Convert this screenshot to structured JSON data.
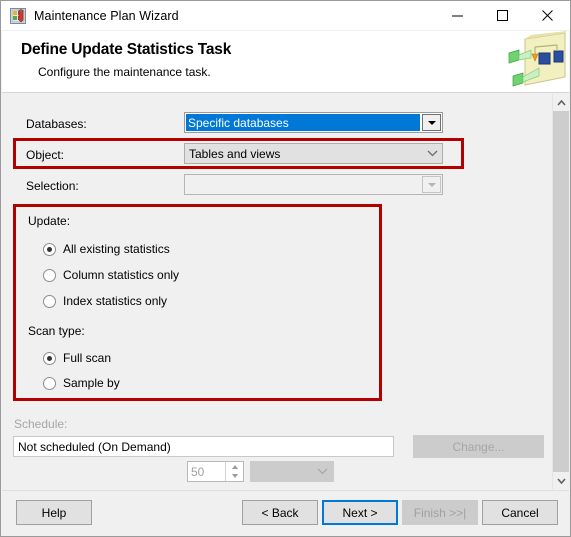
{
  "window": {
    "title": "Maintenance Plan Wizard",
    "icon": "maintenance-plan-icon",
    "caption_buttons": {
      "minimize": "minimize-icon",
      "maximize": "maximize-icon",
      "close": "close-icon"
    }
  },
  "header": {
    "title": "Define Update Statistics Task",
    "subtitle": "Configure the maintenance task.",
    "art": "maintenance-plan-diagram-icon"
  },
  "form": {
    "databases": {
      "label": "Databases:",
      "value": "Specific databases",
      "state": "selected"
    },
    "object": {
      "label": "Object:",
      "value": "Tables and views",
      "state": "enabled",
      "highlighted": true
    },
    "selection": {
      "label": "Selection:",
      "value": "",
      "placeholder": "",
      "state": "disabled"
    }
  },
  "update_group": {
    "highlighted": true,
    "title": "Update:",
    "options": [
      {
        "label": "All existing statistics",
        "checked": true
      },
      {
        "label": "Column statistics only",
        "checked": false
      },
      {
        "label": "Index statistics only",
        "checked": false
      }
    ],
    "scan_type": {
      "title": "Scan type:",
      "options": [
        {
          "label": "Full scan",
          "checked": true
        },
        {
          "label": "Sample by",
          "checked": false
        }
      ],
      "sample_value": "50",
      "sample_units": "",
      "sample_state": "disabled"
    }
  },
  "schedule": {
    "label": "Schedule:",
    "value": "Not scheduled (On Demand)",
    "change_button": "Change...",
    "change_state": "disabled"
  },
  "scrollbar": {
    "up_arrow": "chevron-up-icon",
    "down_arrow": "chevron-down-icon"
  },
  "footer": {
    "help": "Help",
    "back": "< Back",
    "next": "Next >",
    "finish": "Finish >>|",
    "cancel": "Cancel",
    "finish_state": "disabled",
    "next_state": "default"
  },
  "colors": {
    "accent": "#0078d7",
    "highlight_box": "#b30000",
    "window_bg": "#f0f0f0",
    "disabled_text": "#a0a0a0"
  }
}
